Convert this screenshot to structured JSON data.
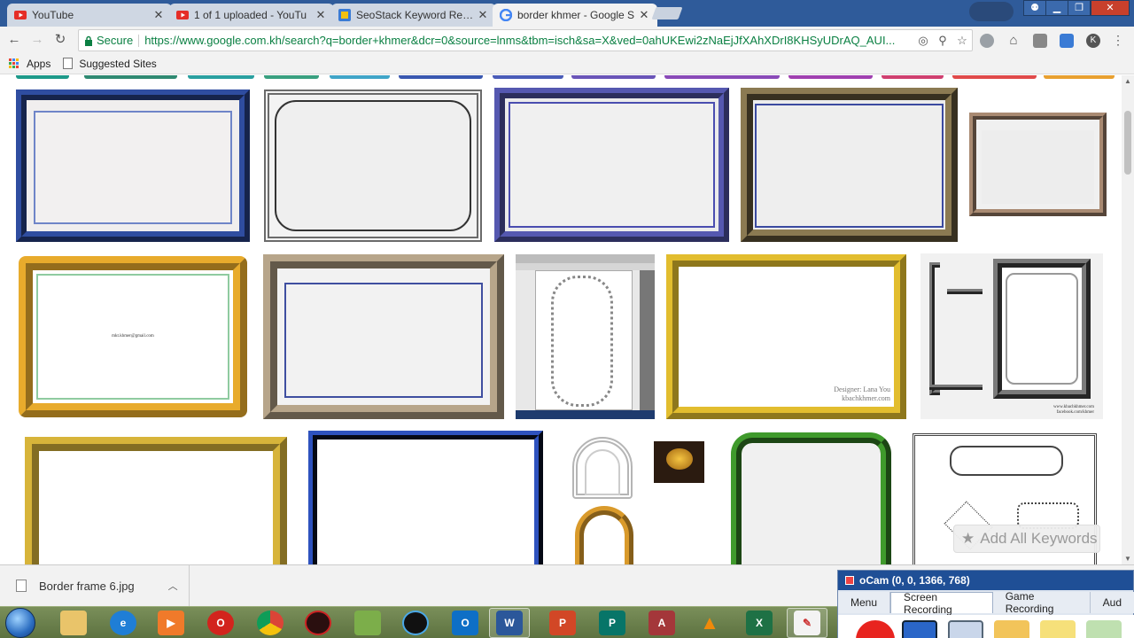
{
  "tabs": [
    {
      "title": "YouTube",
      "icon": "youtube-icon",
      "color": "#e52d27"
    },
    {
      "title": "1 of 1 uploaded - YouTu",
      "icon": "youtube-icon",
      "color": "#e52d27"
    },
    {
      "title": "SeoStack Keyword Resea",
      "icon": "seostack-icon",
      "color": "#3a7bd5"
    },
    {
      "title": "border khmer - Google S",
      "icon": "google-icon",
      "color": "#4285f4"
    }
  ],
  "toolbar": {
    "secure_label": "Secure",
    "url": "https://www.google.com.kh/search?q=border+khmer&dcr=0&source=lnms&tbm=isch&sa=X&ved=0ahUKEwi2zNaEjJfXAhXDrI8KHSyUDrAQ_AUI..."
  },
  "bookmarks": {
    "apps": "Apps",
    "suggested": "Suggested Sites"
  },
  "images": [
    {
      "name": "image-thumb-blue-ornate-frame",
      "color": "#2f4da0"
    },
    {
      "name": "image-thumb-grey-corner-frame",
      "color": "#6b6b6b"
    },
    {
      "name": "image-thumb-purple-ornate-frame",
      "color": "#5558b0"
    },
    {
      "name": "image-thumb-olive-ornate-frame",
      "color": "#8b7a52"
    },
    {
      "name": "image-thumb-brown-small-frame",
      "color": "#a98a72"
    },
    {
      "name": "image-thumb-gold-frame-email",
      "color": "#e8ab2c",
      "text": "mkt.khmer@gmail.com"
    },
    {
      "name": "image-thumb-tan-frame-blue-line",
      "color": "#b7a58a"
    },
    {
      "name": "image-thumb-illustrator-screenshot",
      "color": "#9a9a9a"
    },
    {
      "name": "image-thumb-gold-frame-designer",
      "color": "#e2bd2e",
      "credit1": "Designer: Lana You",
      "credit2": "kbachkhmer.com"
    },
    {
      "name": "image-thumb-grey-ornaments-sheet",
      "color": "#7a7a7a",
      "credit1": "www.kbachkhmer.com",
      "credit2": "facebook.com/khmer"
    },
    {
      "name": "image-thumb-gold-pattern-frame",
      "color": "#d7b43a"
    },
    {
      "name": "image-thumb-dark-blue-frame",
      "color": "#1a2e6a"
    },
    {
      "name": "image-thumb-arch-outline",
      "color": "#b5b5b5"
    },
    {
      "name": "image-thumb-dark-gold-logo",
      "color": "#2b1b10"
    },
    {
      "name": "image-thumb-gold-arch",
      "color": "#d99a2b"
    },
    {
      "name": "image-thumb-green-leaf-frame",
      "color": "#3f9a2c"
    },
    {
      "name": "image-thumb-black-line-frames",
      "color": "#444444"
    }
  ],
  "extension": {
    "add_keywords": "Add All Keywords"
  },
  "downloads": {
    "filename": "Border frame 6.jpg"
  },
  "ocam": {
    "title": "oCam (0, 0, 1366, 768)",
    "tabs": [
      "Menu",
      "Screen Recording",
      "Game Recording",
      "Aud"
    ]
  },
  "taskbar": {
    "apps": [
      "explorer",
      "ie",
      "media-player",
      "opera",
      "chrome",
      "game",
      "minecraft",
      "photo",
      "outlook",
      "word",
      "powerpoint",
      "publisher",
      "access",
      "vlc",
      "excel",
      "paint"
    ]
  }
}
